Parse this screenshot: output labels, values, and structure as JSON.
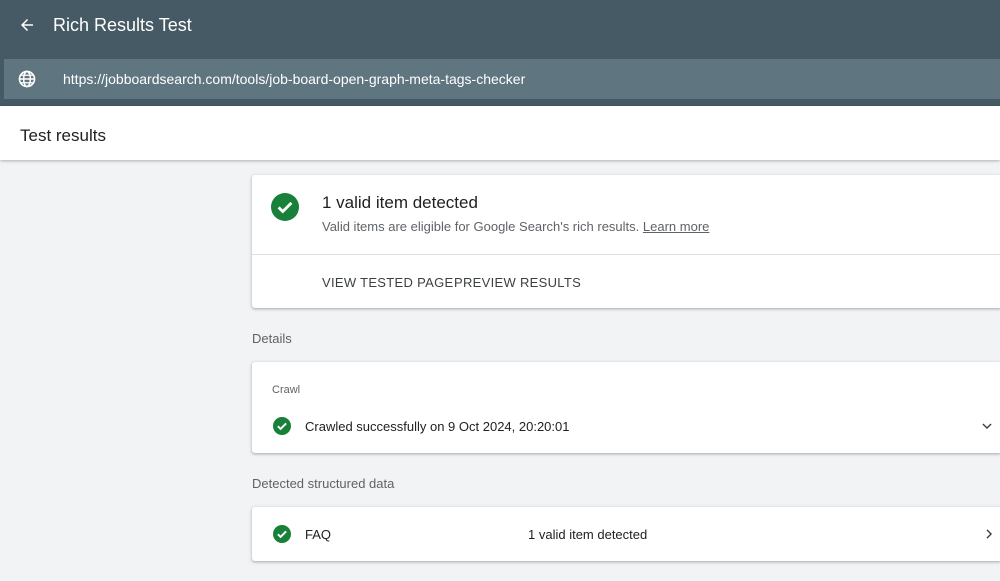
{
  "app": {
    "title": "Rich Results Test",
    "url": "https://jobboardsearch.com/tools/job-board-open-graph-meta-tags-checker"
  },
  "header": {
    "title": "Test results"
  },
  "summary": {
    "title": "1 valid item detected",
    "description": "Valid items are eligible for Google Search's rich results.",
    "learn_more": "Learn more",
    "view_tested_page": "VIEW TESTED PAGE",
    "preview_results": "PREVIEW RESULTS"
  },
  "details": {
    "section_label": "Details",
    "crawl_label": "Crawl",
    "crawl_status": "Crawled successfully on 9 Oct 2024, 20:20:01"
  },
  "structured": {
    "section_label": "Detected structured data",
    "items": [
      {
        "name": "FAQ",
        "status": "1 valid item detected"
      }
    ]
  },
  "colors": {
    "appbar": "#455a64",
    "urlbar": "#5f7681",
    "success": "#188038"
  },
  "icons": {
    "back": "arrow-left-icon",
    "globe": "globe-icon",
    "valid": "check-circle-icon",
    "expand": "chevron-down-icon",
    "open": "chevron-right-icon"
  }
}
